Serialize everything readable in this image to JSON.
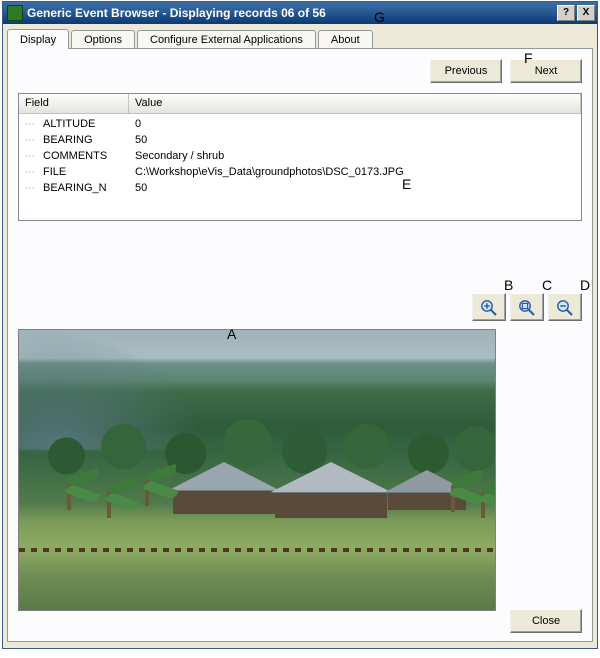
{
  "window": {
    "title": "Generic Event Browser - Displaying records 06 of 56"
  },
  "tabs": {
    "display": "Display",
    "options": "Options",
    "configure": "Configure External Applications",
    "about": "About"
  },
  "nav": {
    "previous": "Previous",
    "next": "Next"
  },
  "table": {
    "headers": {
      "field": "Field",
      "value": "Value"
    },
    "rows": [
      {
        "field": "ALTITUDE",
        "value": "0"
      },
      {
        "field": "BEARING",
        "value": "50"
      },
      {
        "field": "COMMENTS",
        "value": "Secondary / shrub"
      },
      {
        "field": "FILE",
        "value": "C:\\Workshop\\eVis_Data\\groundphotos\\DSC_0173.JPG"
      },
      {
        "field": "BEARING_N",
        "value": "50"
      }
    ]
  },
  "zoom": {
    "in_icon": "zoom-in-icon",
    "fit_icon": "zoom-fit-icon",
    "out_icon": "zoom-out-icon"
  },
  "footer": {
    "close": "Close"
  },
  "annotations": {
    "A": "A",
    "B": "B",
    "C": "C",
    "D": "D",
    "E": "E",
    "F": "F",
    "G": "G"
  }
}
